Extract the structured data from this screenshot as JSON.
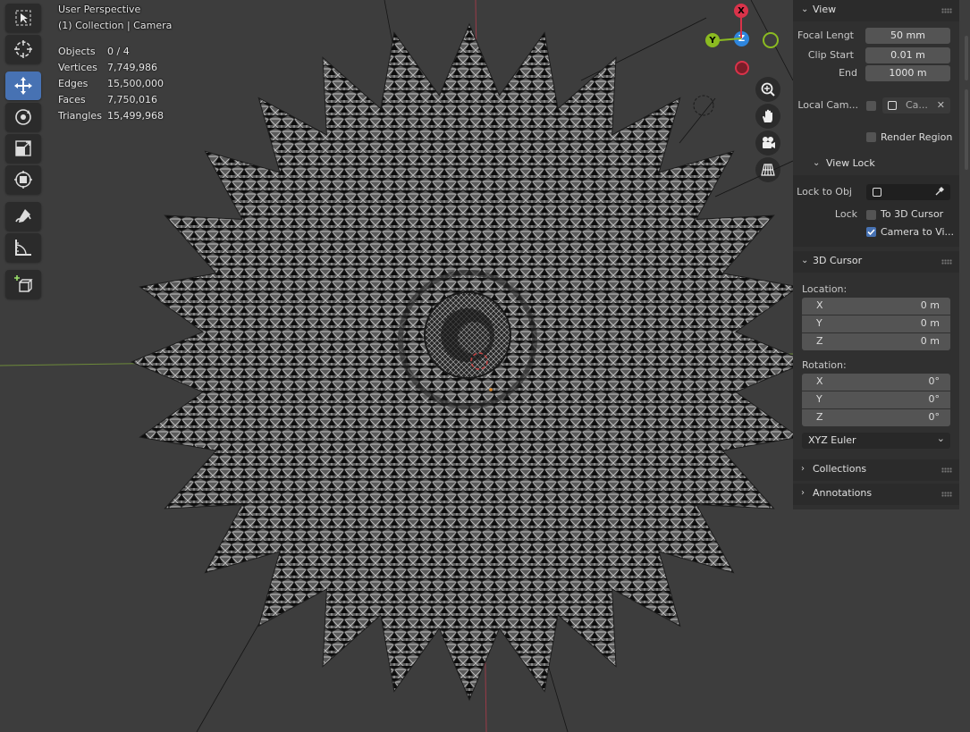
{
  "header": {
    "view_title": "User Perspective",
    "view_subtitle": "(1) Collection | Camera"
  },
  "stats": [
    {
      "label": "Objects",
      "value": "0 / 4"
    },
    {
      "label": "Vertices",
      "value": "7,749,986"
    },
    {
      "label": "Edges",
      "value": "15,500,000"
    },
    {
      "label": "Faces",
      "value": "7,750,016"
    },
    {
      "label": "Triangles",
      "value": "15,499,968"
    }
  ],
  "toolbar": {
    "tools": [
      {
        "name": "select-box-tool",
        "icon": "select-box-icon",
        "active": false
      },
      {
        "name": "cursor-tool",
        "icon": "cursor-icon",
        "active": false
      },
      {
        "name": "move-tool",
        "icon": "move-icon",
        "active": true
      },
      {
        "name": "rotate-tool",
        "icon": "rotate-icon",
        "active": false
      },
      {
        "name": "scale-tool",
        "icon": "scale-icon",
        "active": false
      },
      {
        "name": "transform-tool",
        "icon": "transform-icon",
        "active": false
      },
      {
        "name": "annotate-tool",
        "icon": "annotate-icon",
        "active": false
      },
      {
        "name": "measure-tool",
        "icon": "measure-icon",
        "active": false
      },
      {
        "name": "add-cube-tool",
        "icon": "add-cube-icon",
        "active": false
      }
    ]
  },
  "gizmo": {
    "x_label": "X",
    "y_label": "Y",
    "z_label": "Z",
    "colors": {
      "x": "#d9334a",
      "y": "#8bbb21",
      "z": "#2e86de"
    }
  },
  "sidebar": {
    "view": {
      "title": "View",
      "focal_length_label": "Focal Lengt",
      "focal_length_value": "50 mm",
      "clip_start_label": "Clip Start",
      "clip_start_value": "0.01 m",
      "clip_end_label": "End",
      "clip_end_value": "1000 m",
      "local_camera_label": "Local Cam...",
      "local_camera_value": "Ca...",
      "render_region_label": "Render Region"
    },
    "view_lock": {
      "title": "View Lock",
      "lock_to_obj_label": "Lock to Obj",
      "lock_label": "Lock",
      "to_3d_cursor_label": "To 3D Cursor",
      "camera_to_view_label": "Camera to Vi..."
    },
    "cursor": {
      "title": "3D Cursor",
      "location_label": "Location:",
      "location": [
        {
          "axis": "X",
          "value": "0 m"
        },
        {
          "axis": "Y",
          "value": "0 m"
        },
        {
          "axis": "Z",
          "value": "0 m"
        }
      ],
      "rotation_label": "Rotation:",
      "rotation": [
        {
          "axis": "X",
          "value": "0°"
        },
        {
          "axis": "Y",
          "value": "0°"
        },
        {
          "axis": "Z",
          "value": "0°"
        }
      ],
      "rotation_mode": "XYZ Euler"
    },
    "collections_title": "Collections",
    "annotations_title": "Annotations"
  },
  "colors": {
    "background": "#3d3d3d",
    "active_tool": "#4772b3",
    "panel": "#303030",
    "field": "#545454"
  }
}
